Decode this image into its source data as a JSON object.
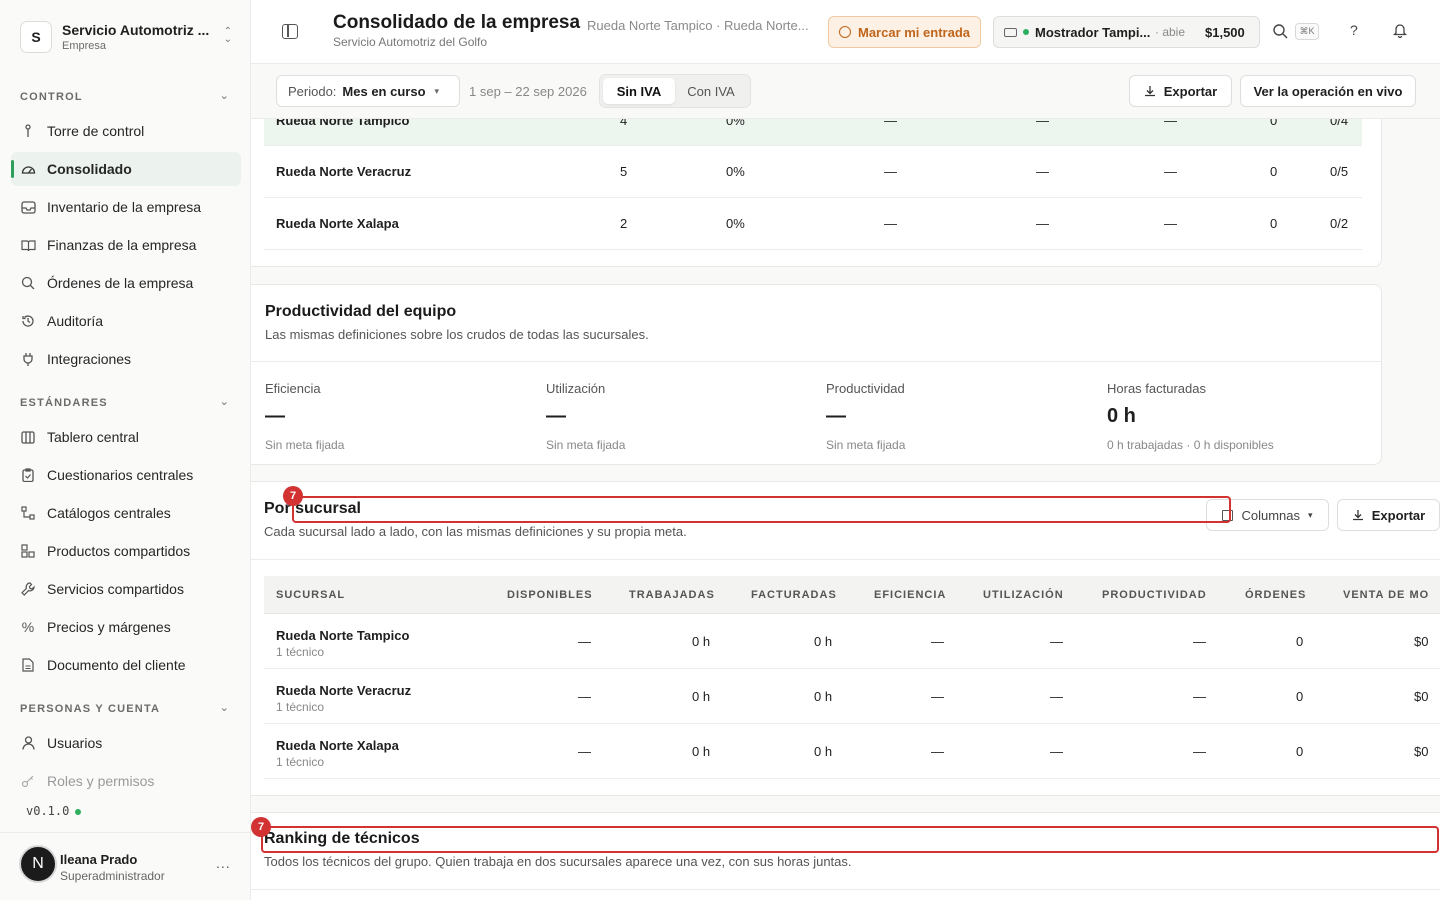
{
  "sidebar": {
    "workspace": {
      "initial": "S",
      "name": "Servicio Automotriz ...",
      "subtitle": "Empresa"
    },
    "sections": [
      {
        "title": "CONTROL"
      },
      {
        "title": "ESTÁNDARES"
      },
      {
        "title": "PERSONAS Y CUENTA"
      }
    ],
    "items": {
      "torre": "Torre de control",
      "consolidado": "Consolidado",
      "inventario": "Inventario de la empresa",
      "finanzas": "Finanzas de la empresa",
      "ordenes": "Órdenes de la empresa",
      "auditoria": "Auditoría",
      "integraciones": "Integraciones",
      "tablero": "Tablero central",
      "cuestionarios": "Cuestionarios centrales",
      "catalogos": "Catálogos centrales",
      "productos": "Productos compartidos",
      "servicios": "Servicios compartidos",
      "precios": "Precios y márgenes",
      "documento": "Documento del cliente",
      "usuarios": "Usuarios",
      "roles": "Roles y permisos"
    },
    "version": "v0.1.0",
    "user": {
      "initial": "N",
      "name": "Ileana Prado",
      "role": "Superadministrador",
      "more": "..."
    }
  },
  "topbar": {
    "title": "Consolidado de la empresa",
    "subtitle": "Servicio Automotriz del Golfo",
    "crumb": "Rueda Norte Tampico · Rueda Norte...",
    "entrada_label": "Marcar mi entrada",
    "register": {
      "name": "Mostrador Tampi...",
      "status": "· abie",
      "amount": "$1,500"
    },
    "shortcut": "⌘K",
    "help": "?"
  },
  "filters": {
    "periodo_label": "Periodo:",
    "periodo_value": "Mes en curso",
    "range": "1 sep – 22 sep 2026",
    "tax_options": [
      "Sin IVA",
      "Con IVA"
    ],
    "tax_selected": "Sin IVA",
    "export_label": "Exportar",
    "live_label": "Ver la operación en vivo"
  },
  "top_table": {
    "rows": [
      {
        "name": "Rueda Norte Tampico",
        "c1": "4",
        "c2": "0%",
        "c3": "—",
        "c4": "—",
        "c5": "—",
        "c6": "0",
        "c7": "0/4"
      },
      {
        "name": "Rueda Norte Veracruz",
        "c1": "5",
        "c2": "0%",
        "c3": "—",
        "c4": "—",
        "c5": "—",
        "c6": "0",
        "c7": "0/5"
      },
      {
        "name": "Rueda Norte Xalapa",
        "c1": "2",
        "c2": "0%",
        "c3": "—",
        "c4": "—",
        "c5": "—",
        "c6": "0",
        "c7": "0/2"
      }
    ]
  },
  "productividad": {
    "title": "Productividad del equipo",
    "description": "Las mismas definiciones sobre los crudos de todas las sucursales.",
    "kpis": [
      {
        "label": "Eficiencia",
        "value": "—",
        "sub": "Sin meta fijada"
      },
      {
        "label": "Utilización",
        "value": "—",
        "sub": "Sin meta fijada"
      },
      {
        "label": "Productividad",
        "value": "—",
        "sub": "Sin meta fijada"
      },
      {
        "label": "Horas facturadas",
        "value": "0 h",
        "sub": "0 h trabajadas · 0 h disponibles"
      }
    ]
  },
  "por_sucursal": {
    "title": "Por sucursal",
    "description": "Cada sucursal lado a lado, con las mismas definiciones y su propia meta.",
    "columns_label": "Columnas",
    "export_label": "Exportar",
    "headers": [
      "SUCURSAL",
      "DISPONIBLES",
      "TRABAJADAS",
      "FACTURADAS",
      "EFICIENCIA",
      "UTILIZACIÓN",
      "PRODUCTIVIDAD",
      "ÓRDENES",
      "VENTA DE MO"
    ],
    "rows": [
      {
        "name": "Rueda Norte Tampico",
        "sub": "1 técnico",
        "disp": "—",
        "trab": "0 h",
        "fact": "0 h",
        "efic": "—",
        "util": "—",
        "prod": "—",
        "ord": "0",
        "venta": "$0"
      },
      {
        "name": "Rueda Norte Veracruz",
        "sub": "1 técnico",
        "disp": "—",
        "trab": "0 h",
        "fact": "0 h",
        "efic": "—",
        "util": "—",
        "prod": "—",
        "ord": "0",
        "venta": "$0"
      },
      {
        "name": "Rueda Norte Xalapa",
        "sub": "1 técnico",
        "disp": "—",
        "trab": "0 h",
        "fact": "0 h",
        "efic": "—",
        "util": "—",
        "prod": "—",
        "ord": "0",
        "venta": "$0"
      }
    ]
  },
  "ranking": {
    "title": "Ranking de técnicos",
    "description": "Todos los técnicos del grupo. Quien trabaja en dos sucursales aparece una vez, con sus horas juntas."
  },
  "annotations": {
    "badge_1": "7",
    "badge_2": "7"
  },
  "colors": {
    "accent_green": "#2f9e5b",
    "annotation_red": "#d23232",
    "warning_orange": "#c0651a"
  }
}
